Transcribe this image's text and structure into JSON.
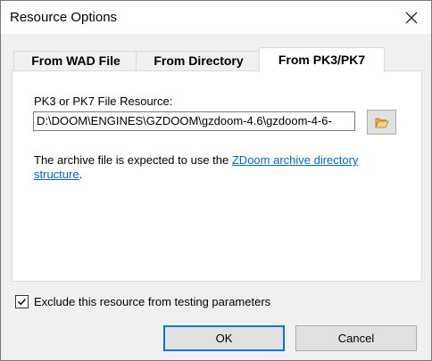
{
  "window": {
    "title": "Resource Options",
    "close_icon": "close-icon"
  },
  "tabs": [
    {
      "label": "From WAD File",
      "active": false
    },
    {
      "label": "From Directory",
      "active": false
    },
    {
      "label": "From PK3/PK7",
      "active": true
    }
  ],
  "panel": {
    "field_label": "PK3 or PK7 File Resource:",
    "path_value": "D:\\DOOM\\ENGINES\\GZDOOM\\gzdoom-4.6\\gzdoom-4-6-",
    "browse_icon": "folder-open-icon",
    "info_text": "The archive file is expected to use the ",
    "info_link": "ZDoom archive directory structure",
    "info_suffix": "."
  },
  "options": {
    "exclude_label": "Exclude this resource from testing parameters",
    "exclude_checked": true
  },
  "buttons": {
    "ok": "OK",
    "cancel": "Cancel"
  },
  "colors": {
    "accent": "#0078d7",
    "link": "#0066cc"
  }
}
